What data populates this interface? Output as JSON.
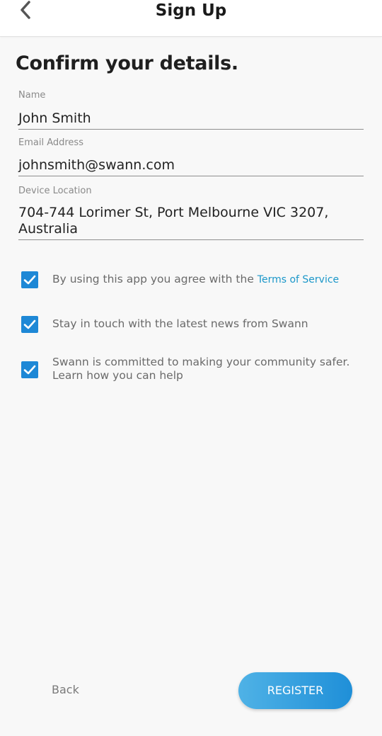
{
  "header": {
    "title": "Sign Up",
    "back_icon": "chevron-left-icon"
  },
  "heading": "Confirm your details.",
  "fields": {
    "name": {
      "label": "Name",
      "value": "John Smith"
    },
    "email": {
      "label": "Email Address",
      "value": "johnsmith@swann.com"
    },
    "location": {
      "label": "Device Location",
      "value": "704-744 Lorimer St, Port Melbourne VIC 3207, Australia"
    }
  },
  "checkboxes": {
    "terms": {
      "text": "By using this app you agree with the ",
      "link": "Terms of Service",
      "checked": true
    },
    "news": {
      "text": "Stay in touch with the latest news from Swann",
      "checked": true
    },
    "community": {
      "text": "Swann is committed to making your community safer. Learn how you can help",
      "checked": true
    }
  },
  "footer": {
    "back_label": "Back",
    "register_label": "REGISTER"
  },
  "colors": {
    "accent": "#1e88d6",
    "link": "#1b97c9",
    "button_gradient_start": "#4fb2e6",
    "button_gradient_end": "#1f8fd8"
  }
}
